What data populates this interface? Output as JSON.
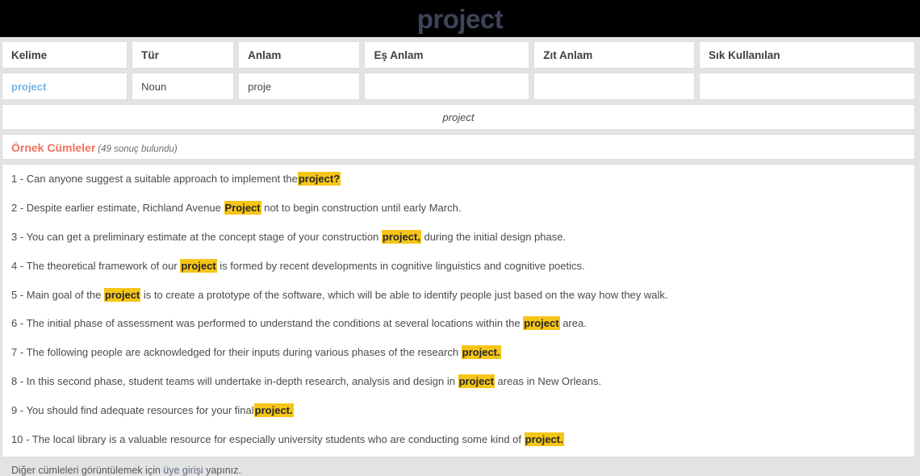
{
  "banner": {
    "title": "project",
    "title_color": "#3d4458",
    "background": "#000000"
  },
  "word_table": {
    "headers": [
      "Kelime",
      "Tür",
      "Anlam",
      "Eş Anlam",
      "Zıt Anlam",
      "Sık Kullanılan"
    ],
    "row": {
      "kelime": "project",
      "kelime_link_color": "#6fb5e8",
      "tur": "Noun",
      "anlam": "proje",
      "es_anlam": "",
      "zit_anlam": "",
      "sik_kullanilan": ""
    }
  },
  "center_word": "project",
  "examples_header": {
    "title": "Örnek Cümleler",
    "title_color": "#f2705e",
    "count_text": "(49 sonuç bulundu)"
  },
  "highlight_color": "#f5c518",
  "examples": [
    {
      "number": "1 - ",
      "before": "Can anyone suggest a suitable approach to implement the",
      "highlight": "project?",
      "after": ""
    },
    {
      "number": "2 - ",
      "before": "Despite earlier estimate, Richland Avenue ",
      "highlight": "Project",
      "after": " not to begin construction until early March."
    },
    {
      "number": "3 - ",
      "before": "You can get a preliminary estimate at the concept stage of your construction ",
      "highlight": "project,",
      "after": " during the initial design phase."
    },
    {
      "number": "4 - ",
      "before": "The theoretical framework of our ",
      "highlight": "project",
      "after": " is formed by recent developments in cognitive linguistics and cognitive poetics."
    },
    {
      "number": "5 - ",
      "before": "Main goal of the ",
      "highlight": "project",
      "after": " is to create a prototype of the software, which will be able to identify people just based on the way how they walk."
    },
    {
      "number": "6 - ",
      "before": "The initial phase of assessment was performed to understand the conditions at several locations within the ",
      "highlight": "project",
      "after": " area."
    },
    {
      "number": "7 - ",
      "before": "The following people are acknowledged for their inputs during various phases of the research ",
      "highlight": "project.",
      "after": ""
    },
    {
      "number": "8 - ",
      "before": "In this second phase, student teams will undertake in-depth research, analysis and design in ",
      "highlight": "project",
      "after": " areas in New Orleans."
    },
    {
      "number": "9 - ",
      "before": "You should find adequate resources for your final",
      "highlight": "project.",
      "after": ""
    },
    {
      "number": "10 - ",
      "before": "The local library is a valuable resource for especially university students who are conducting some kind of ",
      "highlight": "project.",
      "after": ""
    }
  ],
  "footnote": {
    "before": "Diğer cümleleri görüntülemek için ",
    "link": "üye girişi",
    "after": " yapınız."
  }
}
